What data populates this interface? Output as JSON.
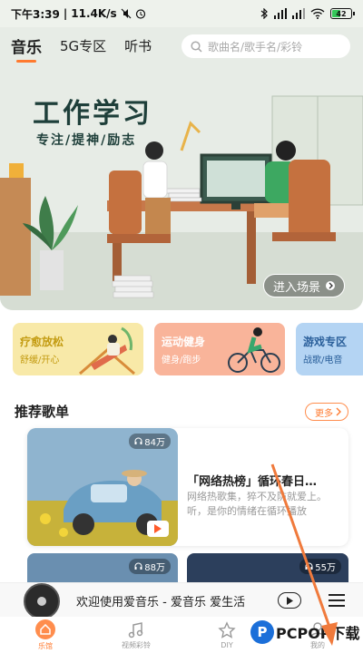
{
  "status_bar": {
    "time": "下午3:39",
    "network_speed": "11.4K/s",
    "battery_level": "42"
  },
  "top_nav": {
    "tabs": [
      {
        "label": "音乐",
        "active": true
      },
      {
        "label": "5G专区",
        "active": false
      },
      {
        "label": "听书",
        "active": false
      }
    ],
    "search_placeholder": "歌曲名/歌手名/彩铃"
  },
  "hero": {
    "title": "工作学习",
    "subtitle": "专注/提神/励志",
    "cta_label": "进入场景"
  },
  "categories": [
    {
      "title": "疗愈放松",
      "subtitle": "舒缓/开心"
    },
    {
      "title": "运动健身",
      "subtitle": "健身/跑步"
    },
    {
      "title": "游戏专区",
      "subtitle": "战歌/电音"
    }
  ],
  "recommended": {
    "section_title": "推荐歌单",
    "more_label": "更多",
    "featured": {
      "play_count": "84万",
      "name": "「网络热榜」循环春日…",
      "description": "网络热歌集，猝不及防就爱上。听，是你的情绪在循环播放"
    },
    "more_cards": [
      {
        "play_count": "88万"
      },
      {
        "play_count": "55万"
      }
    ]
  },
  "mini_player": {
    "text": "欢迎使用爱音乐 - 爱音乐  爱生活"
  },
  "tab_bar": {
    "items": [
      {
        "label": "乐馆",
        "active": true
      },
      {
        "label": "视频彩铃",
        "active": false
      },
      {
        "label": "DIY",
        "active": false
      },
      {
        "label": "我的",
        "active": false
      }
    ]
  },
  "watermark": {
    "text": "PCPOP下载"
  },
  "colors": {
    "accent": "#ff7a2f",
    "hero_bg": "#e7ece6",
    "watermark_blue": "#1b6fd9",
    "arrow": "#f07a3c"
  }
}
